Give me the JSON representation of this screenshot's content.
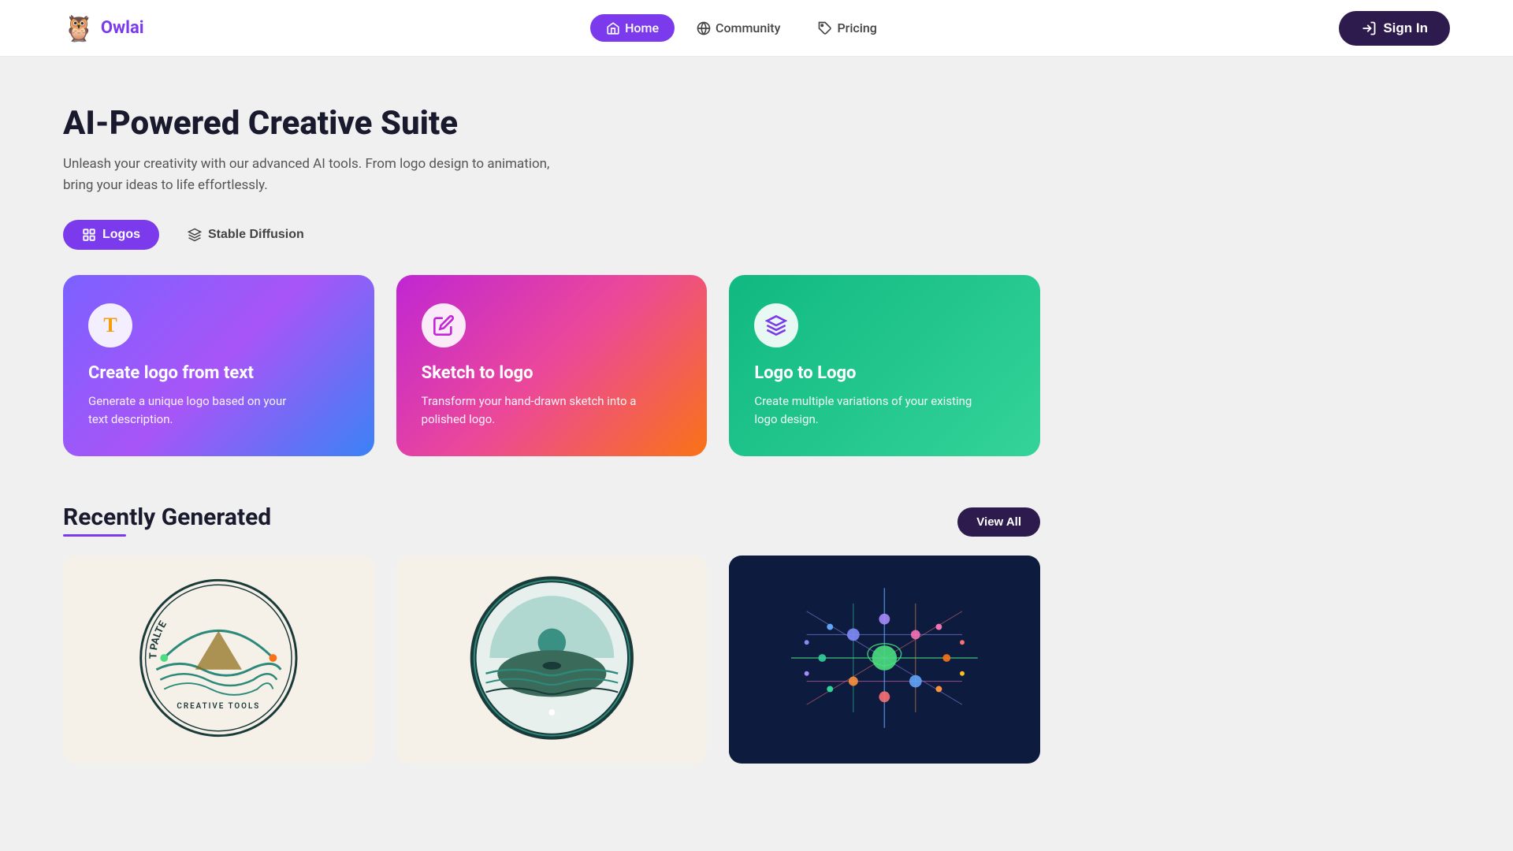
{
  "logo": {
    "text": "Owlai",
    "icon": "🦉"
  },
  "nav": {
    "items": [
      {
        "id": "home",
        "label": "Home",
        "active": true,
        "icon": "home"
      },
      {
        "id": "community",
        "label": "Community",
        "active": false,
        "icon": "globe"
      },
      {
        "id": "pricing",
        "label": "Pricing",
        "active": false,
        "icon": "tag"
      }
    ],
    "signin_label": "Sign In"
  },
  "hero": {
    "title": "AI-Powered Creative Suite",
    "description": "Unleash your creativity with our advanced AI tools. From logo design to animation, bring your ideas to life effortlessly."
  },
  "tabs": [
    {
      "id": "logos",
      "label": "Logos",
      "active": true
    },
    {
      "id": "stable-diffusion",
      "label": "Stable Diffusion",
      "active": false
    }
  ],
  "cards": [
    {
      "id": "text-to-logo",
      "title": "Create logo from text",
      "description": "Generate a unique logo based on your text description.",
      "icon": "T",
      "icon_color": "#f59e0b",
      "gradient": "card-1"
    },
    {
      "id": "sketch-to-logo",
      "title": "Sketch to logo",
      "description": "Transform your hand-drawn sketch into a polished logo.",
      "icon": "✏️",
      "gradient": "card-2"
    },
    {
      "id": "logo-to-logo",
      "title": "Logo to Logo",
      "description": "Create multiple variations of your existing logo design.",
      "icon": "layers",
      "gradient": "card-3"
    }
  ],
  "recently_generated": {
    "title": "Recently Generated",
    "view_all_label": "View All"
  }
}
